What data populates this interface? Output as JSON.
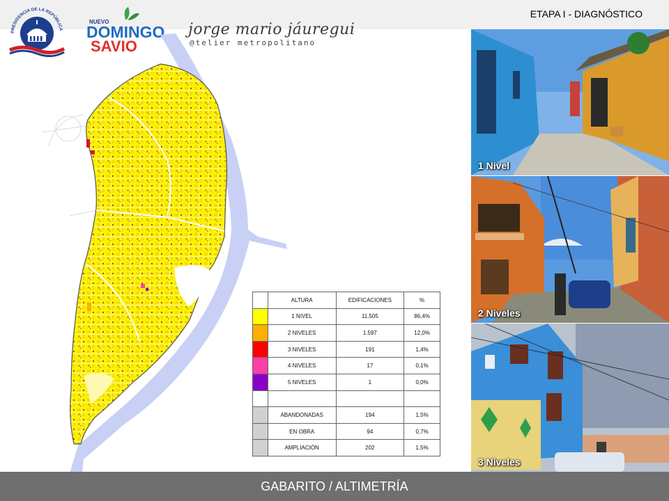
{
  "header": {
    "stage": "ETAPA I - DIAGNÓSTICO",
    "seal_text": "PRESIDENCIA DE LA REPÚBLICA DOMINICANA",
    "logo_nuevo": "NUEVO",
    "logo_domingo": "DOMINGO",
    "logo_savio": "SAVIO",
    "brand_name": "jorge mario jáuregui",
    "brand_sub": "@telier metropolitano"
  },
  "colors": {
    "1_nivel": "#ffff00",
    "2_niveles": "#f9b000",
    "3_niveles": "#ff0000",
    "4_niveles": "#ff3ea5",
    "5_niveles": "#8a00c8",
    "grey_swatch": "#d0d0d0",
    "river": "#c9d0f5",
    "footer_bg": "#6f6f6f"
  },
  "table": {
    "header": [
      "ALTURA",
      "EDIFICACIONES",
      "%"
    ],
    "rows": [
      [
        "1 NIVEL",
        "11.505",
        "86,4%"
      ],
      [
        "2 NIVELES",
        "1.597",
        "12,0%"
      ],
      [
        "3 NIVELES",
        "191",
        "1,4%"
      ],
      [
        "4 NIVELES",
        "17",
        "0,1%"
      ],
      [
        "5 NIVELES",
        "1",
        "0,0%"
      ],
      [
        "",
        "",
        ""
      ],
      [
        "ABANDONADAS",
        "194",
        "1,5%"
      ],
      [
        "EN OBRA",
        "94",
        "0,7%"
      ],
      [
        "AMPLIACIÓN",
        "202",
        "1,5%"
      ]
    ]
  },
  "photos": [
    {
      "label": "1 Nivel"
    },
    {
      "label": "2 Niveles"
    },
    {
      "label": "3 Niveles"
    }
  ],
  "footer": {
    "title": "GABARITO  / ALTIMETRÍA"
  }
}
